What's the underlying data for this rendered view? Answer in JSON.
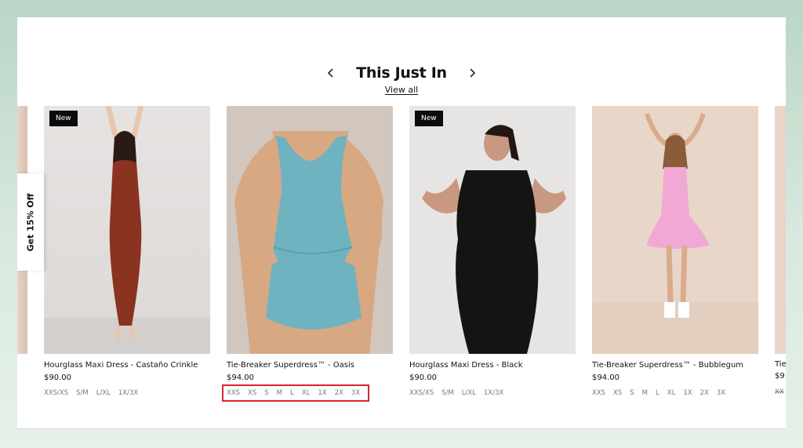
{
  "section": {
    "title": "This Just In",
    "view_all": "View all"
  },
  "promo": {
    "label": "Get 15% Off"
  },
  "products": [
    {
      "badge": "New",
      "name": "Hourglass Maxi Dress - Castaño Crinkle",
      "price": "$90.00",
      "sizes": [
        "XXS/XS",
        "S/M",
        "L/XL",
        "1X/3X"
      ],
      "color": "#8a3320"
    },
    {
      "badge": "",
      "name": "Tie-Breaker Superdress™ - Oasis",
      "price": "$94.00",
      "sizes": [
        "XXS",
        "XS",
        "S",
        "M",
        "L",
        "XL",
        "1X",
        "2X",
        "3X"
      ],
      "color": "#6fb3c0"
    },
    {
      "badge": "New",
      "name": "Hourglass Maxi Dress - Black",
      "price": "$90.00",
      "sizes": [
        "XXS/XS",
        "S/M",
        "L/XL",
        "1X/3X"
      ],
      "color": "#111111"
    },
    {
      "badge": "",
      "name": "Tie-Breaker Superdress™ - Bubblegum",
      "price": "$94.00",
      "sizes": [
        "XXS",
        "XS",
        "S",
        "M",
        "L",
        "XL",
        "1X",
        "2X",
        "3X"
      ],
      "color": "#f2a8d4"
    }
  ],
  "partial_product": {
    "name": "Tie",
    "price": "$9",
    "size": "XX"
  }
}
